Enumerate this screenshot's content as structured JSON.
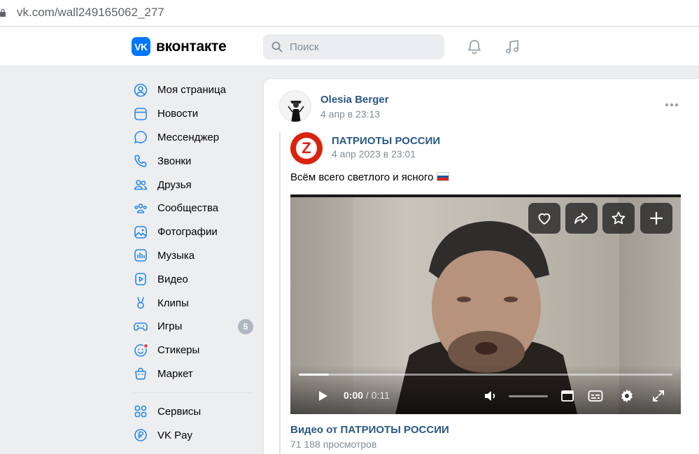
{
  "browser": {
    "url": "vk.com/wall249165062_277"
  },
  "header": {
    "logo_mark": "VK",
    "logo_text": "вконтакте",
    "search_placeholder": "Поиск",
    "brand_color": "#0077ff"
  },
  "sidebar": {
    "items": [
      {
        "label": "Моя страница",
        "icon": "user-circle-icon"
      },
      {
        "label": "Новости",
        "icon": "news-icon"
      },
      {
        "label": "Мессенджер",
        "icon": "message-icon"
      },
      {
        "label": "Звонки",
        "icon": "phone-icon"
      },
      {
        "label": "Друзья",
        "icon": "friends-icon"
      },
      {
        "label": "Сообщества",
        "icon": "communities-icon"
      },
      {
        "label": "Фотографии",
        "icon": "photo-icon"
      },
      {
        "label": "Музыка",
        "icon": "music-icon"
      },
      {
        "label": "Видео",
        "icon": "video-icon"
      },
      {
        "label": "Клипы",
        "icon": "clips-icon"
      },
      {
        "label": "Игры",
        "icon": "gamepad-icon",
        "badge": "5"
      },
      {
        "label": "Стикеры",
        "icon": "sticker-icon"
      },
      {
        "label": "Маркет",
        "icon": "market-bag-icon"
      }
    ],
    "secondary": [
      {
        "label": "Сервисы",
        "icon": "services-icon"
      },
      {
        "label": "VK Pay",
        "icon": "vkpay-icon"
      }
    ]
  },
  "post": {
    "author": "Olesia Berger",
    "date": "4 апр в 23:13",
    "repost": {
      "group": "ПАТРИОТЫ РОССИИ",
      "avatar_letter": "Z",
      "date": "4 апр 2023 в 23:01",
      "text": "Всём всего светлого и ясного",
      "video": {
        "current_time": "0:00",
        "separator": " / ",
        "duration": "0:11",
        "progress_fraction": 0.08,
        "volume_fraction": 0.0
      },
      "video_title": "Видео от ПАТРИОТЫ РОССИИ",
      "views": "71 188 просмотров"
    }
  },
  "colors": {
    "link": "#2a5885",
    "muted": "#818c99",
    "accent_red": "#d9230f"
  }
}
